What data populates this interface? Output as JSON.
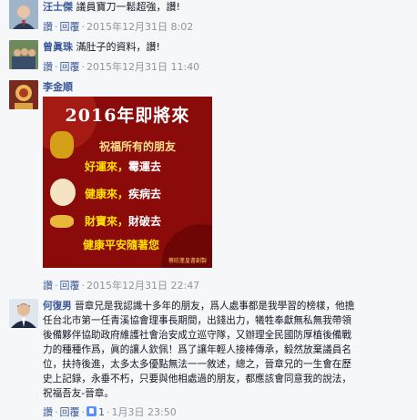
{
  "comments": [
    {
      "name": "汪士傑",
      "text": "議員寶刀一鬆超強，讚!",
      "actions": [
        "讚",
        "回覆"
      ],
      "time": "2015年12月31日 8:02"
    },
    {
      "name": "曾眞珠",
      "text": "滿肚子的資料，讚!",
      "actions": [
        "讚",
        "回覆"
      ],
      "time": "2015年12月31日 11:40"
    },
    {
      "name": "李金順",
      "text": "",
      "actions": [
        "讚",
        "回覆"
      ],
      "time": "2015年12月31日 22:47",
      "card": {
        "title": "2016年即將來",
        "subtitle": "祝福所有的朋友",
        "lines": [
          {
            "a": "好運來，",
            "b": "霉運去"
          },
          {
            "a": "健康來，",
            "b": "疾病去"
          },
          {
            "a": "財寶來，",
            "b": "財破去"
          },
          {
            "a": "健康平安隨著您",
            "b": ""
          }
        ],
        "footer": "蔡昉蓬皇書創製"
      }
    },
    {
      "name": "何復男",
      "text_lines": [
        "晉章兄是我認識十多年的朋友，爲人處事都是我學習的榜樣，他擔",
        "任台北市第一任青溪協會理事長期間，出錢出力，犧牲奉獻無私無我帶領",
        "後備夥伴協助政府維護社會治安成立巡守隊，又辦理全民國防厚植後備戰",
        "力的種種作爲，眞的讓人欽佩！爲了讓年輕人接棒傳承，毅然放棄議員名",
        "位，扶持後進，太多太多優點無法一一敘述，總之，晉章兄的一生會在歷",
        "史上記錄，永垂不朽，只要與他相處過的朋友，都應該會同意我的說法，",
        "祝福吾友-晉章。"
      ],
      "actions": [
        "讚",
        "回覆"
      ],
      "likes": "1",
      "time": "1月3日 23:50"
    }
  ]
}
